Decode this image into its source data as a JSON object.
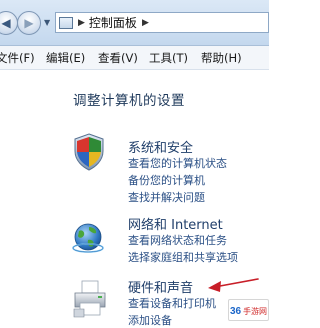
{
  "address_bar": {
    "path_root_icon": "control-panel-icon",
    "path_label": "控制面板"
  },
  "menu": {
    "items": [
      "文件(F)",
      "编辑(E)",
      "查看(V)",
      "工具(T)",
      "帮助(H)"
    ]
  },
  "main": {
    "title": "调整计算机的设置",
    "categories": [
      {
        "icon": "shield-security-icon",
        "title": "系统和安全",
        "links": [
          "查看您的计算机状态",
          "备份您的计算机",
          "查找并解决问题"
        ]
      },
      {
        "icon": "network-globe-icon",
        "title": "网络和 Internet",
        "links": [
          "查看网络状态和任务",
          "选择家庭组和共享选项"
        ]
      },
      {
        "icon": "printer-hardware-icon",
        "title": "硬件和声音",
        "links": [
          "查看设备和打印机",
          "添加设备"
        ]
      }
    ]
  },
  "watermark": {
    "text": "36手游网"
  },
  "colors": {
    "link": "#2a4f85",
    "title": "#1f3e6a",
    "annotation_arrow": "#c81e28"
  }
}
